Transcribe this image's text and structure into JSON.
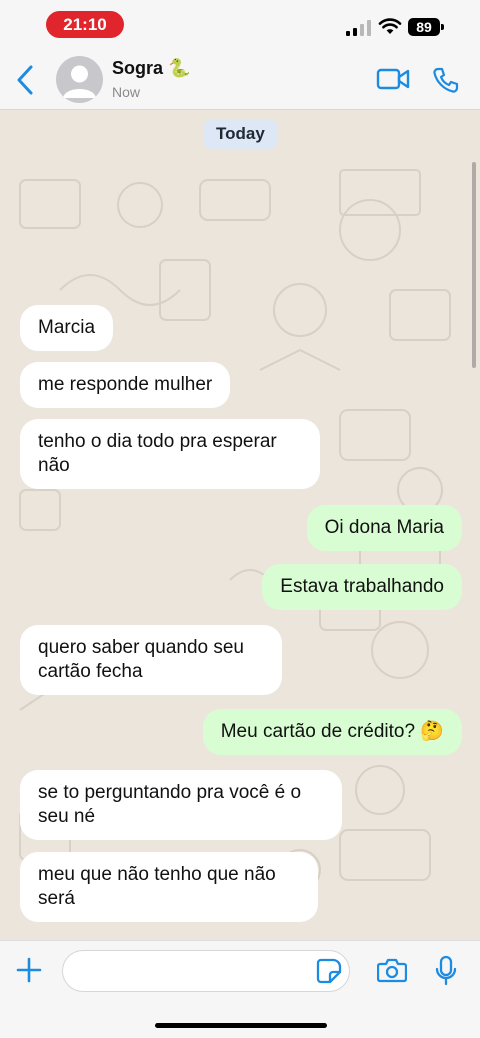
{
  "status_bar": {
    "time": "21:10",
    "battery": "89"
  },
  "header": {
    "contact_name": "Sogra 🐍",
    "contact_status": "Now"
  },
  "chat": {
    "date_label": "Today",
    "messages": [
      {
        "direction": "in",
        "text": "Marcia"
      },
      {
        "direction": "in",
        "text": "me responde mulher"
      },
      {
        "direction": "in",
        "text": "tenho o dia todo pra esperar\nnão"
      },
      {
        "direction": "out",
        "text": "Oi dona Maria"
      },
      {
        "direction": "out",
        "text": "Estava trabalhando"
      },
      {
        "direction": "in",
        "text": "quero saber quando seu\ncartão fecha"
      },
      {
        "direction": "out",
        "text": "Meu cartão de crédito? 🤔"
      },
      {
        "direction": "in",
        "text": "se to perguntando pra você é o\nseu né"
      },
      {
        "direction": "in",
        "text": "meu que não tenho que não\nserá"
      }
    ]
  },
  "input_bar": {
    "message_value": ""
  },
  "icons": {
    "back": "chevron-left-icon",
    "avatar": "person-icon",
    "video": "video-camera-icon",
    "call": "phone-icon",
    "plus": "plus-icon",
    "sticker": "sticker-icon",
    "camera": "camera-icon",
    "mic": "microphone-icon"
  },
  "colors": {
    "accent": "#1d8be0",
    "outgoing_bubble": "#d9fdd3",
    "incoming_bubble": "#ffffff",
    "time_pill": "#e0252c"
  }
}
